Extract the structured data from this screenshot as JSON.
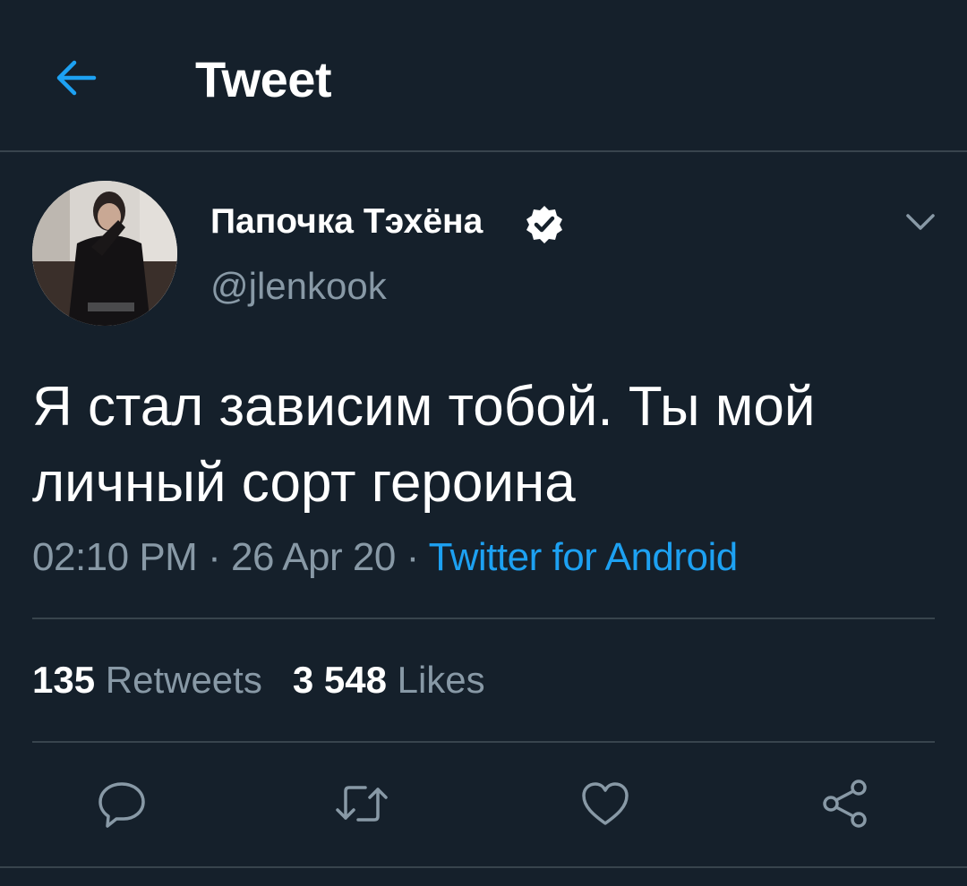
{
  "header": {
    "title": "Tweet",
    "back_icon": "arrow-left-icon"
  },
  "author": {
    "display_name": "Папочка Тэхёна",
    "handle": "@jlenkook",
    "verified_icon": "verified-badge-icon"
  },
  "tweet": {
    "text_line1": "Я стал зависим тобой. Ты мой",
    "text_line2": "личный сорт героина",
    "time": "02:10 PM",
    "date": "26 Apr 20",
    "separator": "·",
    "source": "Twitter for Android"
  },
  "stats": {
    "retweets_count": "135",
    "retweets_label": "Retweets",
    "likes_count": "3 548",
    "likes_label": "Likes"
  },
  "actions": [
    "reply-icon",
    "retweet-icon",
    "like-icon",
    "share-icon"
  ],
  "colors": {
    "background": "#15202b",
    "accent": "#1da1f2",
    "secondary_text": "#8899a6",
    "divider": "#38444d"
  }
}
